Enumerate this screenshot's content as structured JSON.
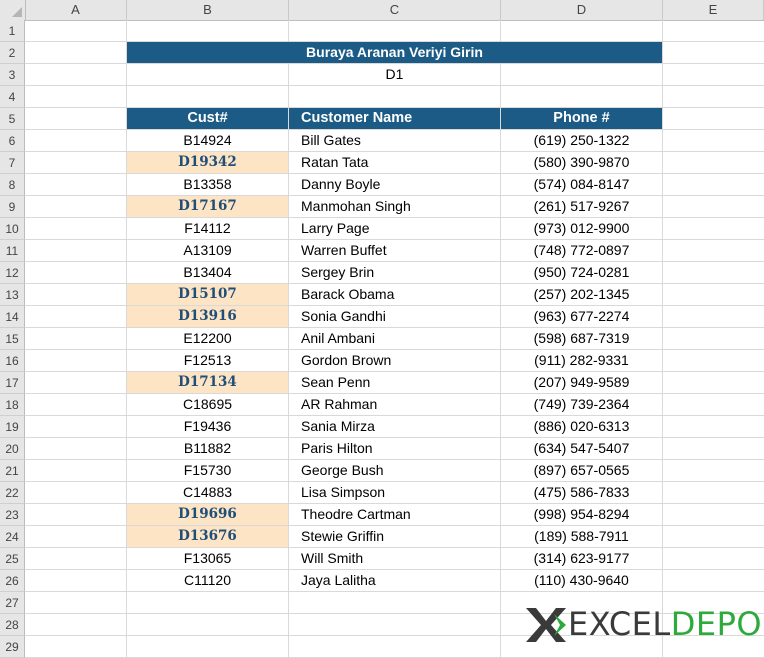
{
  "columns": [
    "A",
    "B",
    "C",
    "D",
    "E"
  ],
  "rows": [
    "1",
    "2",
    "3",
    "4",
    "5",
    "6",
    "7",
    "8",
    "9",
    "10",
    "11",
    "12",
    "13",
    "14",
    "15",
    "16",
    "17",
    "18",
    "19",
    "20",
    "21",
    "22",
    "23",
    "24",
    "25",
    "26",
    "27",
    "28",
    "29"
  ],
  "banner": {
    "title": "Buraya Aranan Veriyi Girin",
    "value": "D1"
  },
  "table": {
    "headers": [
      "Cust#",
      "Customer Name",
      "Phone #"
    ],
    "rows": [
      {
        "cust": "B14924",
        "name": "Bill Gates",
        "phone": "(619) 250-1322",
        "highlight": false
      },
      {
        "cust": "D19342",
        "name": "Ratan Tata",
        "phone": "(580) 390-9870",
        "highlight": true
      },
      {
        "cust": "B13358",
        "name": "Danny Boyle",
        "phone": "(574) 084-8147",
        "highlight": false
      },
      {
        "cust": "D17167",
        "name": "Manmohan Singh",
        "phone": "(261) 517-9267",
        "highlight": true
      },
      {
        "cust": "F14112",
        "name": "Larry Page",
        "phone": "(973) 012-9900",
        "highlight": false
      },
      {
        "cust": "A13109",
        "name": "Warren Buffet",
        "phone": "(748) 772-0897",
        "highlight": false
      },
      {
        "cust": "B13404",
        "name": "Sergey Brin",
        "phone": "(950) 724-0281",
        "highlight": false
      },
      {
        "cust": "D15107",
        "name": "Barack Obama",
        "phone": "(257) 202-1345",
        "highlight": true
      },
      {
        "cust": "D13916",
        "name": "Sonia Gandhi",
        "phone": "(963) 677-2274",
        "highlight": true
      },
      {
        "cust": "E12200",
        "name": "Anil Ambani",
        "phone": "(598) 687-7319",
        "highlight": false
      },
      {
        "cust": "F12513",
        "name": "Gordon Brown",
        "phone": "(911) 282-9331",
        "highlight": false
      },
      {
        "cust": "D17134",
        "name": "Sean Penn",
        "phone": "(207) 949-9589",
        "highlight": true
      },
      {
        "cust": "C18695",
        "name": "AR Rahman",
        "phone": "(749) 739-2364",
        "highlight": false
      },
      {
        "cust": "F19436",
        "name": "Sania Mirza",
        "phone": "(886) 020-6313",
        "highlight": false
      },
      {
        "cust": "B11882",
        "name": "Paris Hilton",
        "phone": "(634) 547-5407",
        "highlight": false
      },
      {
        "cust": "F15730",
        "name": "George Bush",
        "phone": "(897) 657-0565",
        "highlight": false
      },
      {
        "cust": "C14883",
        "name": "Lisa Simpson",
        "phone": "(475) 586-7833",
        "highlight": false
      },
      {
        "cust": "D19696",
        "name": "Theodre Cartman",
        "phone": "(998) 954-8294",
        "highlight": true
      },
      {
        "cust": "D13676",
        "name": "Stewie Griffin",
        "phone": "(189) 588-7911",
        "highlight": true
      },
      {
        "cust": "F13065",
        "name": "Will Smith",
        "phone": "(314) 623-9177",
        "highlight": false
      },
      {
        "cust": "C11120",
        "name": "Jaya Lalitha",
        "phone": "(110) 430-9640",
        "highlight": false
      }
    ]
  },
  "logo": {
    "part1": "EXCEL",
    "part2": "DEPO",
    "icon": "x-chevron-logo-icon"
  },
  "colors": {
    "header_bg": "#1b5b85",
    "highlight_bg": "#fce4c4",
    "highlight_text": "#1f4e79",
    "logo_green": "#2eaa3b"
  }
}
